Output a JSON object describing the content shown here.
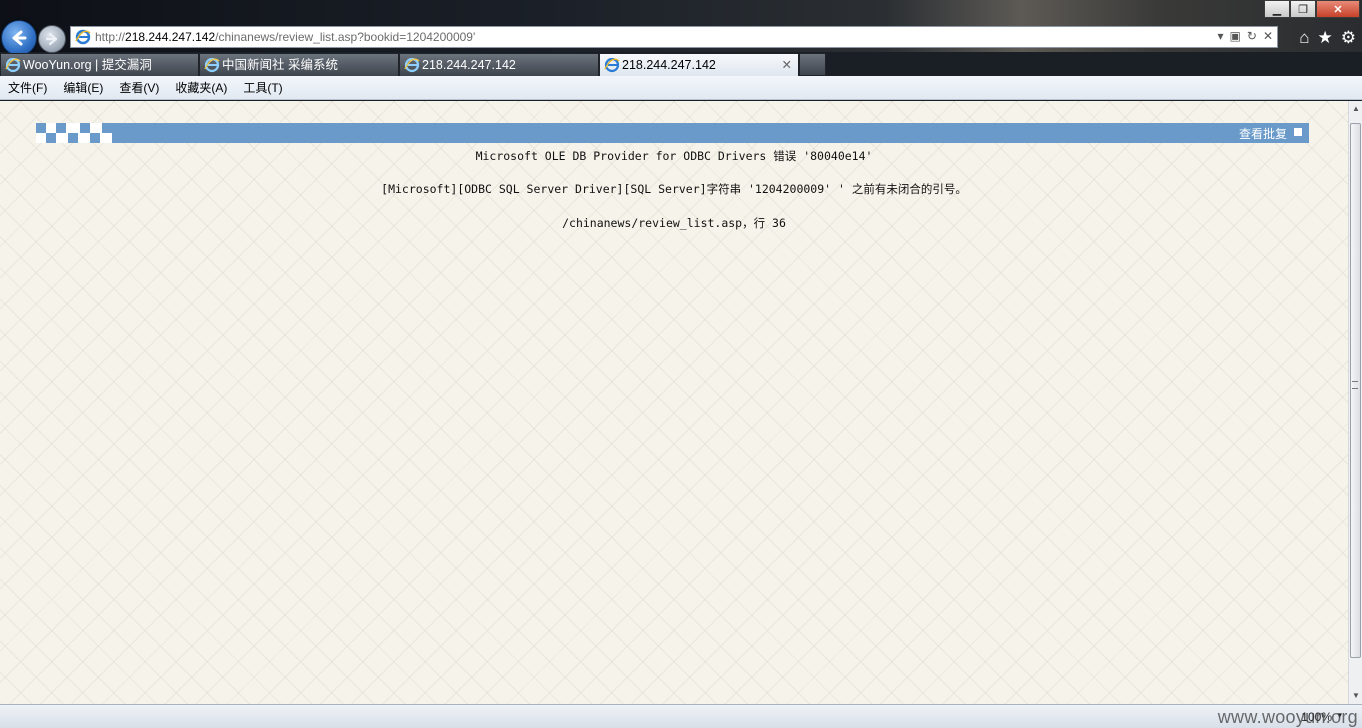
{
  "browser": {
    "url_prefix": "http://",
    "url_host": "218.244.247.142",
    "url_path": "/chinanews/review_list.asp?bookid=1204200009'",
    "tabs": [
      {
        "label": "WooYun.org | 提交漏洞"
      },
      {
        "label": "中国新闻社 采编系统"
      },
      {
        "label": "218.244.247.142"
      },
      {
        "label": "218.244.247.142",
        "active": true
      }
    ],
    "menu": [
      "文件(F)",
      "编辑(E)",
      "查看(V)",
      "收藏夹(A)",
      "工具(T)"
    ],
    "zoom": "100%"
  },
  "page": {
    "header_link": "查看批复",
    "error_title": "Microsoft OLE DB Provider for ODBC Drivers 错误 '80040e14'",
    "error_message": "[Microsoft][ODBC SQL Server Driver][SQL Server]字符串 '1204200009' ' 之前有未闭合的引号。",
    "error_location": "/chinanews/review_list.asp，行 36"
  },
  "watermark": "www.wooyun.org",
  "colors": {
    "band": "#6a9ac9",
    "page_bg": "#f5f3ea",
    "tab_active": "#e8edf4"
  }
}
